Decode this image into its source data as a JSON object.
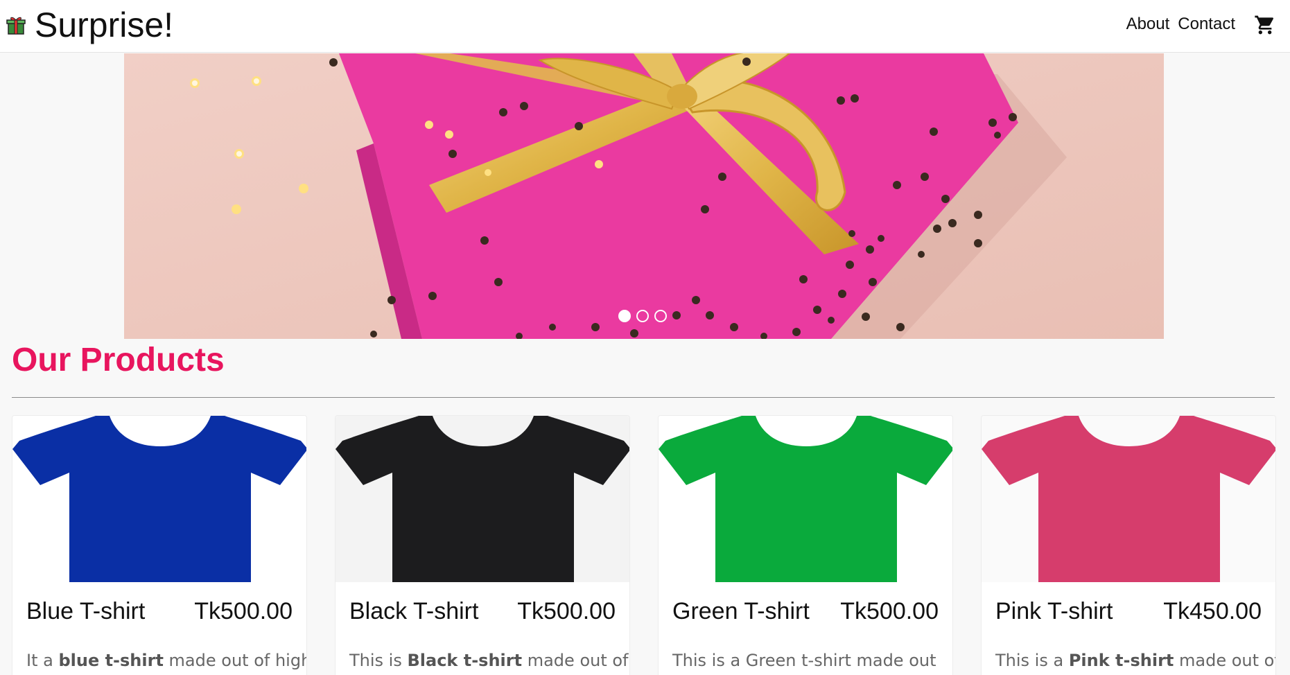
{
  "brand": {
    "title": "Surprise!",
    "icon": "gift-icon"
  },
  "nav": {
    "links": [
      "About",
      "Contact"
    ],
    "cart_icon": "shopping-cart-icon"
  },
  "carousel": {
    "slide_count": 3,
    "active_slide": 0
  },
  "products_section": {
    "title": "Our Products"
  },
  "colors": {
    "accent": "#e8155e",
    "navbar_bg": "#ffffff",
    "page_bg": "#f8f8f8"
  },
  "products": [
    {
      "name": "Blue T-shirt",
      "price": "Tk500.00",
      "desc_pre": "It a ",
      "desc_bold": "blue t-shirt",
      "desc_post": " made out of high",
      "color": "#0a2fa5",
      "bg": "#ffffff"
    },
    {
      "name": "Black T-shirt",
      "price": "Tk500.00",
      "desc_pre": "This is ",
      "desc_bold": "Black t-shirt",
      "desc_post": " made out of",
      "color": "#1c1c1e",
      "bg": "#f3f3f3"
    },
    {
      "name": "Green T-shirt",
      "price": "Tk500.00",
      "desc_pre": "This is a Green t-shirt made out",
      "desc_bold": "",
      "desc_post": "",
      "color": "#0aaa3c",
      "bg": "#ffffff"
    },
    {
      "name": "Pink T-shirt",
      "price": "Tk450.00",
      "desc_pre": "This is a ",
      "desc_bold": "Pink t-shirt",
      "desc_post": " made out of",
      "color": "#d63d6c",
      "bg": "#fafafa"
    }
  ]
}
